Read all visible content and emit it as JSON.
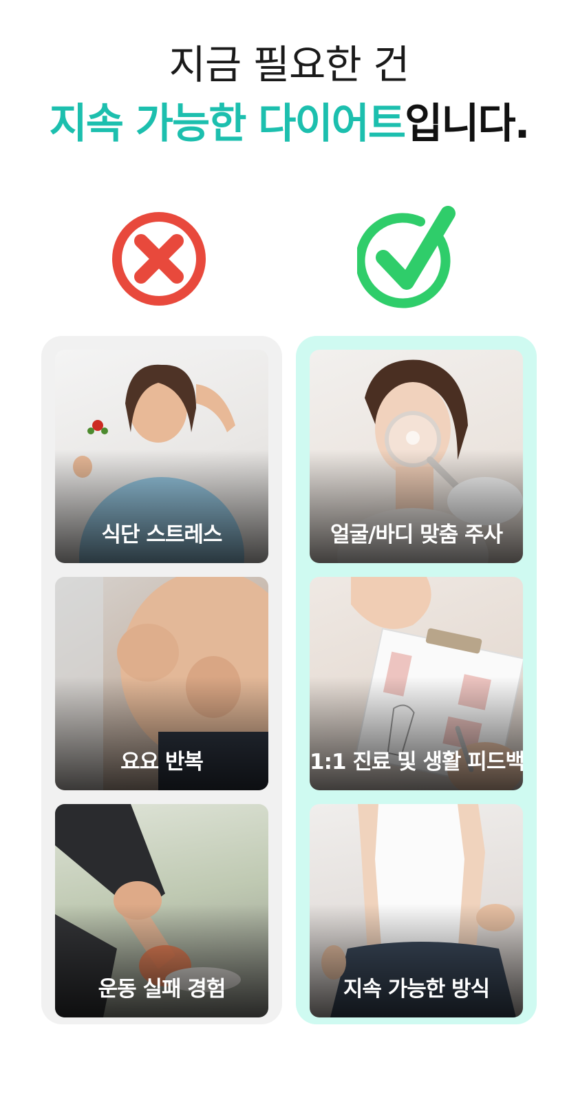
{
  "headline": {
    "line1": "지금 필요한 건",
    "line2_accent": "지속 가능한 다이어트",
    "line2_rest": "입니다."
  },
  "colors": {
    "accent": "#1cbfae",
    "bad_mark": "#e8493c",
    "good_mark": "#2fcd6a",
    "bad_panel": "#f1f1f1",
    "good_panel": "#cffaf1"
  },
  "icons": {
    "bad": "x-circle-icon",
    "good": "checkmark-circle-icon"
  },
  "bad_column": {
    "cards": [
      {
        "caption": "식단 스트레스"
      },
      {
        "caption": "요요 반복"
      },
      {
        "caption": "운동 실패 경험"
      }
    ]
  },
  "good_column": {
    "cards": [
      {
        "caption": "얼굴/바디 맞춤 주사"
      },
      {
        "caption": "1:1 진료 및 생활 피드백"
      },
      {
        "caption": "지속 가능한 방식"
      }
    ]
  }
}
